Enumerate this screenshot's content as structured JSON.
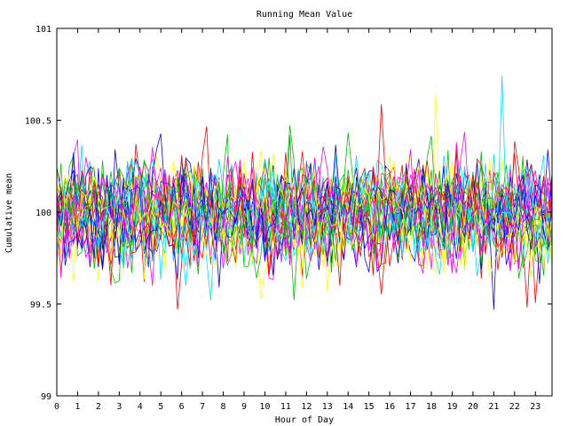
{
  "chart_data": {
    "type": "line",
    "title": "Running Mean Value",
    "xlabel": "Hour of Day",
    "ylabel": "Cumulative mean",
    "xlim": [
      0,
      23.8
    ],
    "ylim": [
      99,
      101
    ],
    "x_ticks": [
      "0",
      "1",
      "2",
      "3",
      "4",
      "5",
      "6",
      "7",
      "8",
      "9",
      "10",
      "11",
      "12",
      "13",
      "14",
      "15",
      "16",
      "17",
      "18",
      "19",
      "20",
      "21",
      "22",
      "23"
    ],
    "y_ticks": [
      "99",
      "99.5",
      "100",
      "100.5",
      "101"
    ],
    "grid": false,
    "legend": "none",
    "series_count": 30,
    "series_center": 100.0,
    "series_spread": 0.22,
    "samples_per_series": 120,
    "series_colors": [
      "#ff0000",
      "#00c000",
      "#0000ff",
      "#ff00ff",
      "#00e0ff",
      "#ffff00"
    ],
    "series_seed": 7
  }
}
